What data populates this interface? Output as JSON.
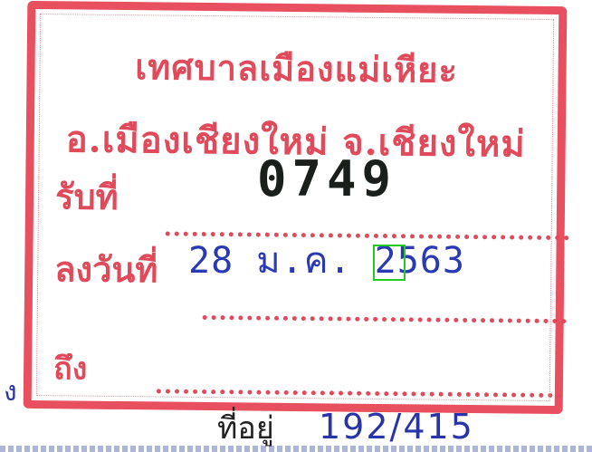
{
  "stamp": {
    "org_line1": "เทศบาลเมืองแม่เหียะ",
    "org_line2": "อ.เมืองเชียงใหม่ จ.เชียงใหม่",
    "label_received_no": "รับที่",
    "label_date": "ลงวันที่",
    "label_to": "ถึง"
  },
  "entries": {
    "received_no": "0749",
    "date": "28 ม.ค. 2563",
    "highlight_text": "63"
  },
  "below": {
    "left_handwriting": "ง",
    "address_label": "ที่อยู่",
    "address_value": "192/415"
  },
  "colors": {
    "stamp": "#e04a5a",
    "ink_blue": "#2a3ab4",
    "ink_black": "#1b1f1c",
    "highlight": "#22cc22"
  }
}
